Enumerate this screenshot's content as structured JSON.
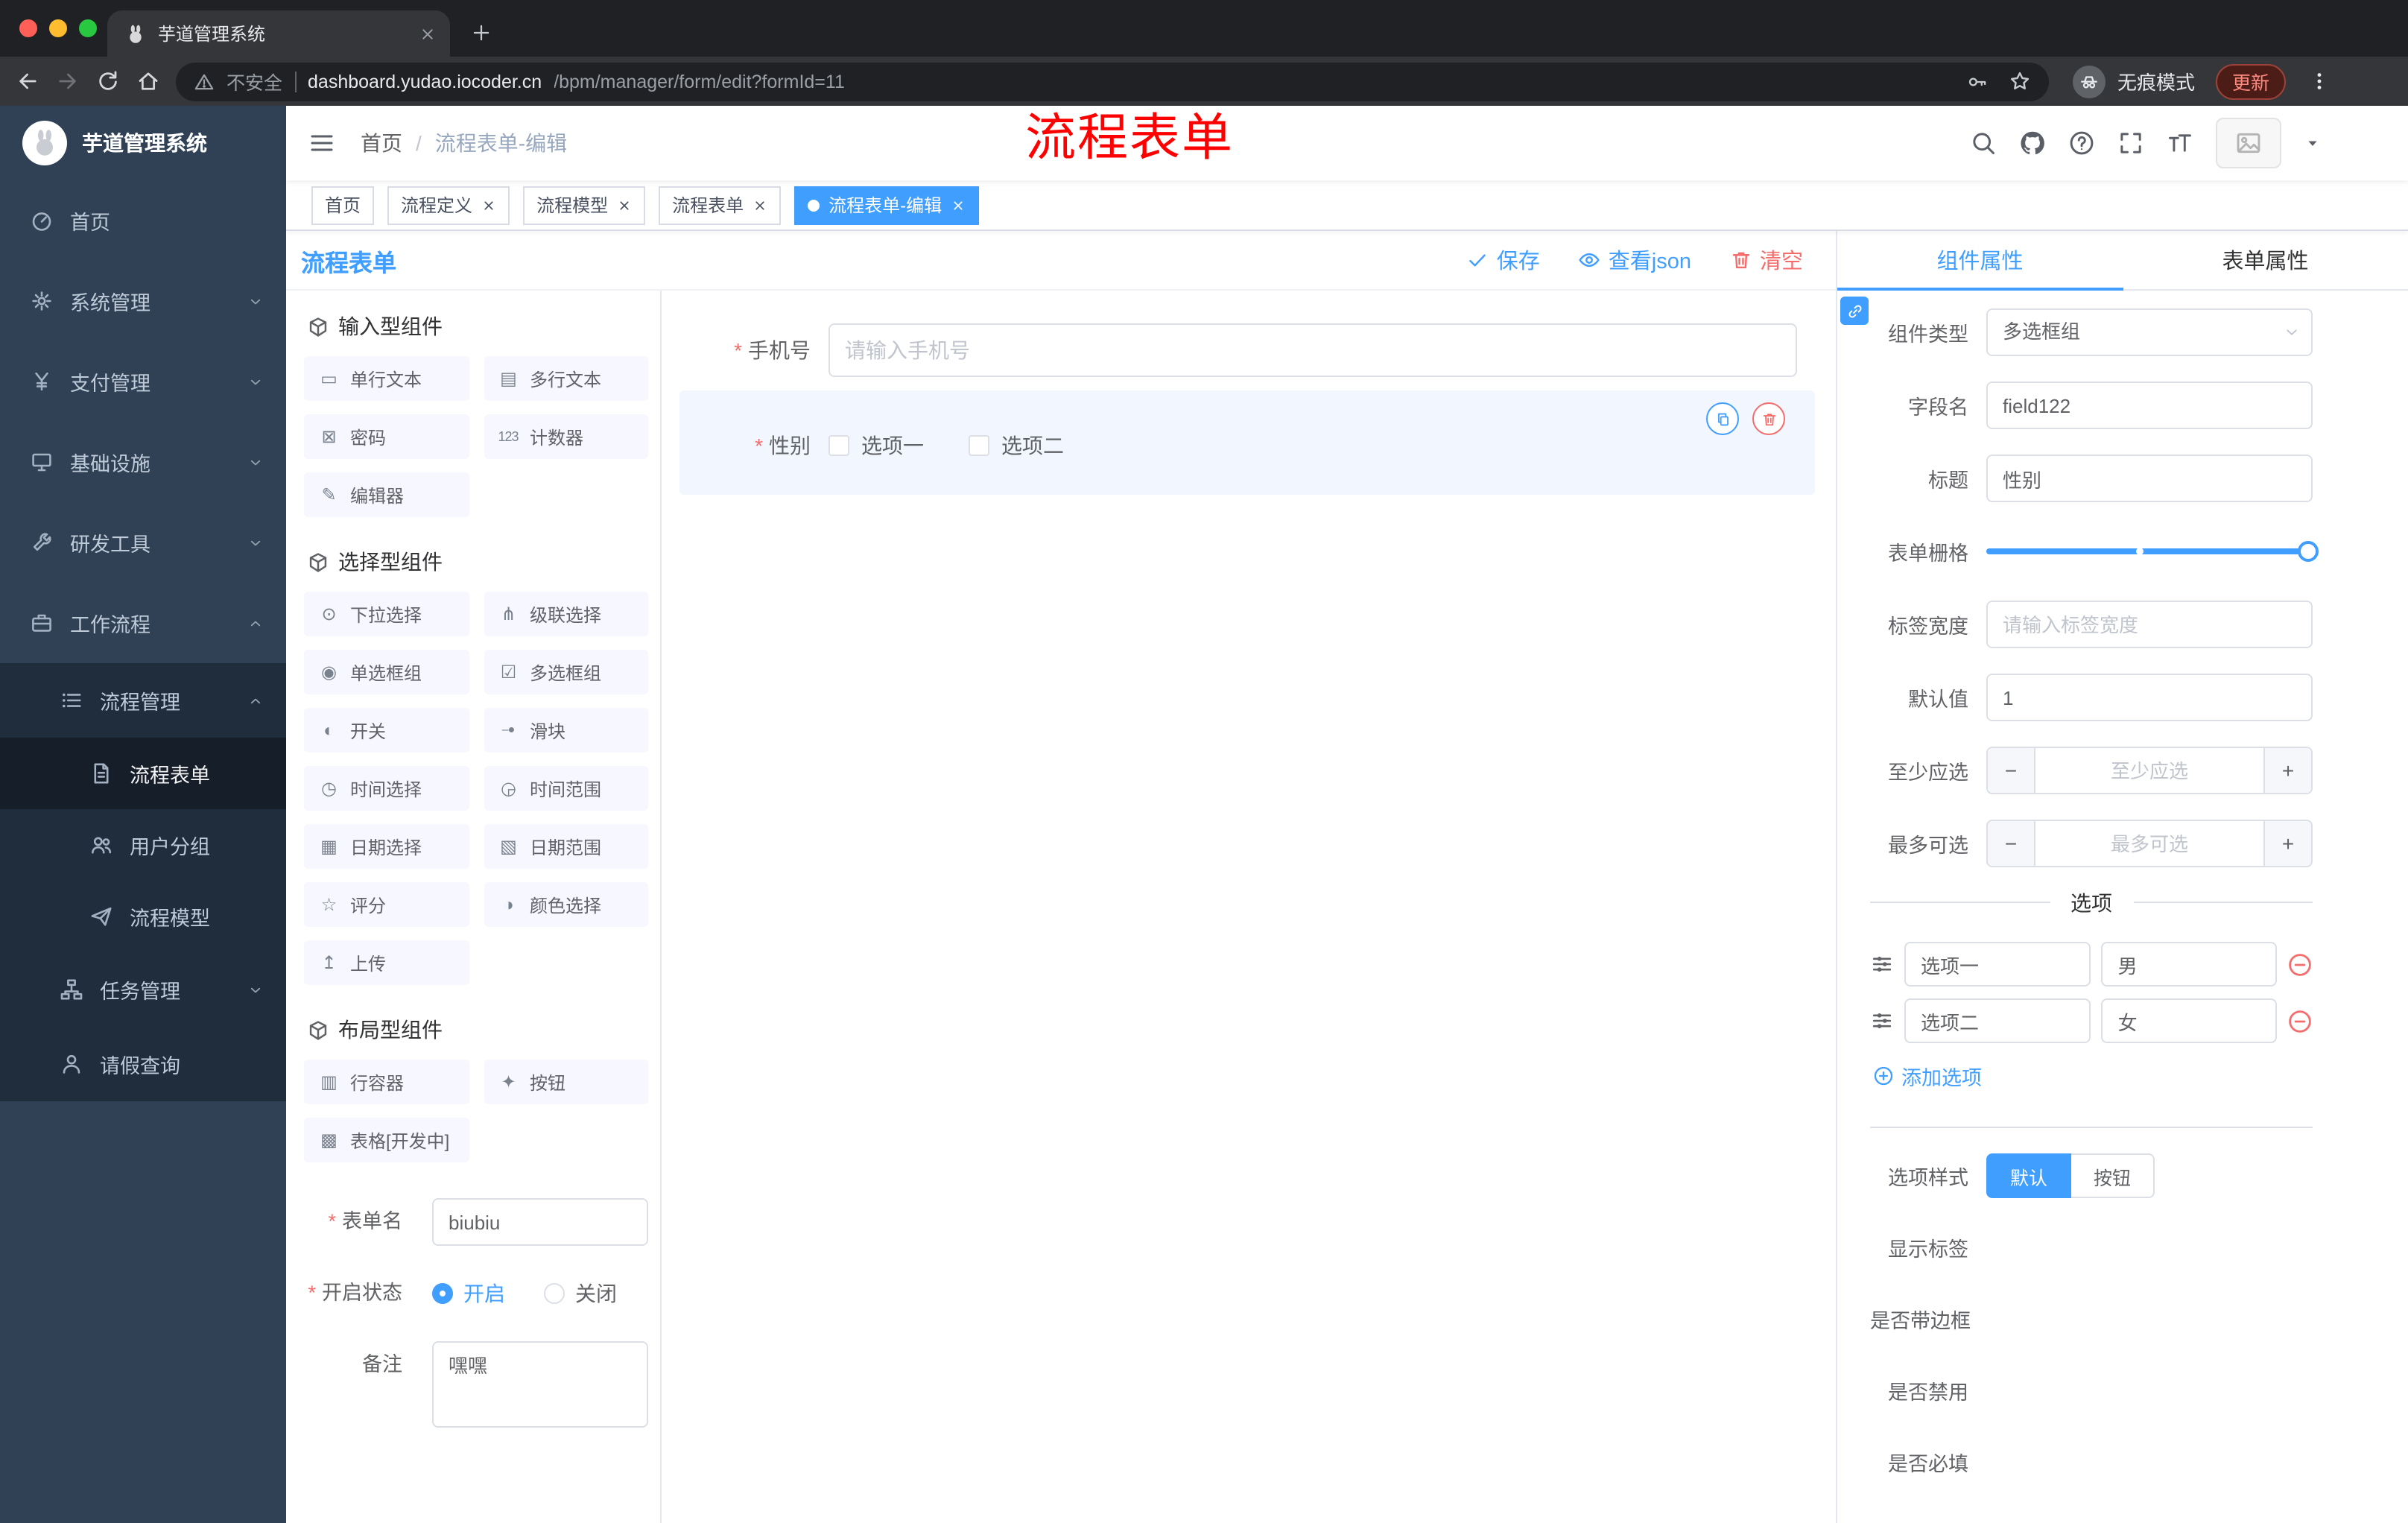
{
  "browser": {
    "tab_title": "芋道管理系统",
    "security_label": "不安全",
    "url_host": "dashboard.yudao.iocoder.cn",
    "url_path": "/bpm/manager/form/edit?formId=11",
    "incognito_label": "无痕模式",
    "update_label": "更新"
  },
  "sidebar": {
    "logo_title": "芋道管理系统",
    "items": [
      {
        "label": "首页"
      },
      {
        "label": "系统管理"
      },
      {
        "label": "支付管理"
      },
      {
        "label": "基础设施"
      },
      {
        "label": "研发工具"
      },
      {
        "label": "工作流程"
      },
      {
        "label": "流程管理"
      },
      {
        "label": "流程表单"
      },
      {
        "label": "用户分组"
      },
      {
        "label": "流程模型"
      },
      {
        "label": "任务管理"
      },
      {
        "label": "请假查询"
      }
    ]
  },
  "navbar": {
    "breadcrumb_home": "首页",
    "breadcrumb_separator": "/",
    "breadcrumb_current": "流程表单-编辑",
    "annotation": "流程表单"
  },
  "tags": [
    {
      "label": "首页"
    },
    {
      "label": "流程定义"
    },
    {
      "label": "流程模型"
    },
    {
      "label": "流程表单"
    },
    {
      "label": "流程表单-编辑"
    }
  ],
  "designer": {
    "title": "流程表单",
    "save_label": "保存",
    "view_json_label": "查看json",
    "clear_label": "清空"
  },
  "palette": {
    "groups": [
      {
        "title": "输入型组件"
      },
      {
        "title": "选择型组件"
      },
      {
        "title": "布局型组件"
      }
    ],
    "input_items": [
      {
        "label": "单行文本",
        "icon": "▭"
      },
      {
        "label": "多行文本",
        "icon": "▤"
      },
      {
        "label": "密码",
        "icon": "⊠"
      },
      {
        "label": "计数器",
        "icon": "123"
      },
      {
        "label": "编辑器",
        "icon": "✎"
      }
    ],
    "select_items": [
      {
        "label": "下拉选择",
        "icon": "⊙"
      },
      {
        "label": "级联选择",
        "icon": "⋔"
      },
      {
        "label": "单选框组",
        "icon": "◉"
      },
      {
        "label": "多选框组",
        "icon": "☑"
      },
      {
        "label": "开关",
        "icon": "◐"
      },
      {
        "label": "滑块",
        "icon": "–●"
      },
      {
        "label": "时间选择",
        "icon": "◷"
      },
      {
        "label": "时间范围",
        "icon": "◶"
      },
      {
        "label": "日期选择",
        "icon": "▦"
      },
      {
        "label": "日期范围",
        "icon": "▧"
      },
      {
        "label": "评分",
        "icon": "☆"
      },
      {
        "label": "颜色选择",
        "icon": "◑"
      },
      {
        "label": "上传",
        "icon": "↥"
      }
    ],
    "layout_items": [
      {
        "label": "行容器",
        "icon": "▥"
      },
      {
        "label": "按钮",
        "icon": "✦"
      },
      {
        "label": "表格[开发中]",
        "icon": "▩"
      }
    ],
    "form": {
      "name_label": "表单名",
      "name_value": "biubiu",
      "status_label": "开启状态",
      "status_on": "开启",
      "status_off": "关闭",
      "remark_label": "备注",
      "remark_value": "嘿嘿"
    }
  },
  "canvas": {
    "phone_label": "手机号",
    "phone_placeholder": "请输入手机号",
    "gender_label": "性别",
    "gender_option1": "选项一",
    "gender_option2": "选项二"
  },
  "props": {
    "tab_component": "组件属性",
    "tab_form": "表单属性",
    "type_label": "组件类型",
    "type_value": "多选框组",
    "field_label": "字段名",
    "field_value": "field122",
    "title_label": "标题",
    "title_value": "性别",
    "grid_label": "表单栅格",
    "width_label": "标签宽度",
    "width_placeholder": "请输入标签宽度",
    "default_label": "默认值",
    "default_value": "1",
    "min_label": "至少应选",
    "min_placeholder": "至少应选",
    "max_label": "最多可选",
    "max_placeholder": "最多可选",
    "options_title": "选项",
    "options": [
      {
        "label": "选项一",
        "value": "男"
      },
      {
        "label": "选项二",
        "value": "女"
      }
    ],
    "add_option_label": "添加选项",
    "style_label": "选项样式",
    "style_default": "默认",
    "style_button": "按钮",
    "show_label": "显示标签",
    "border_label": "是否带边框",
    "disabled_label": "是否禁用",
    "required_label": "是否必填"
  },
  "colors": {
    "accent": "#409EFF",
    "danger": "#F56C6C",
    "annotation": "#FF0000",
    "sidebar_bg": "#304156",
    "sidebar_sub_bg": "#1F2D3D"
  }
}
